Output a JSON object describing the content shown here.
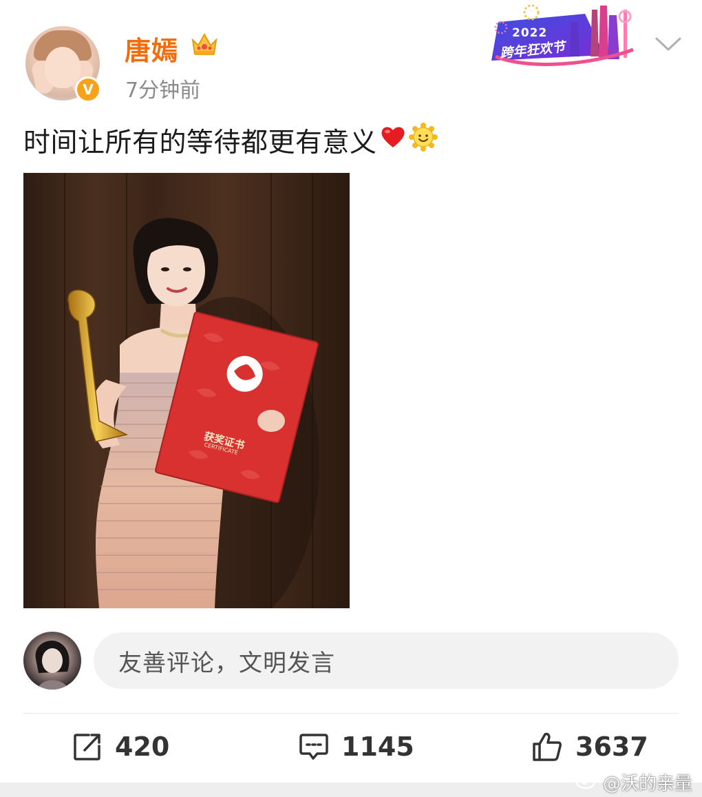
{
  "post": {
    "author": "唐嫣",
    "time": "7分钟前",
    "text": "时间让所有的等待都更有意义",
    "event_badge": {
      "year": "2022",
      "name": "跨年狂欢节"
    },
    "photo": {
      "certificate_title": "获奖证书",
      "certificate_subtitle": "CERTIFICATE"
    }
  },
  "comment_box": {
    "placeholder": "友善评论，文明发言"
  },
  "actions": {
    "shares": "420",
    "comments": "1145",
    "likes": "3637"
  },
  "watermark": "@沃的亲量",
  "colors": {
    "username": "#f26c0d",
    "verified_badge": "#f7a21b",
    "certificate_red": "#d9312f"
  },
  "icons": [
    "crown-icon",
    "verified-badge-icon",
    "chevron-down-icon",
    "heart-emoji",
    "smile-emoji",
    "share-icon",
    "comment-icon",
    "like-icon",
    "weibo-logo-icon"
  ]
}
